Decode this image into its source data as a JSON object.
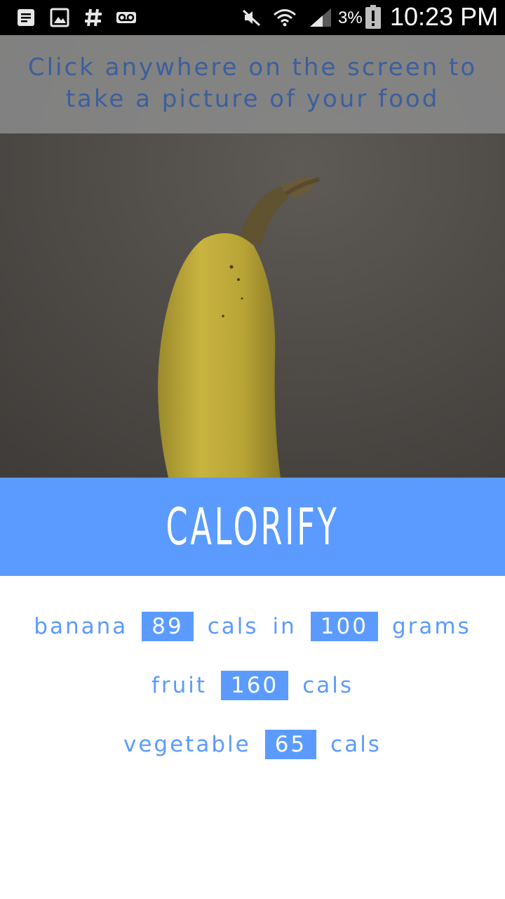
{
  "status_bar": {
    "battery": "3%",
    "time": "10:23 PM",
    "icons": [
      "notes-icon",
      "gallery-icon",
      "hashtag-icon",
      "voicemail-icon",
      "mute-icon",
      "wifi-icon",
      "signal-icon",
      "battery-icon"
    ]
  },
  "camera": {
    "hint": "Click anywhere on the screen to take a picture of your food"
  },
  "banner": {
    "title": "CALORIFY"
  },
  "results": [
    {
      "words": [
        "banana",
        "cals",
        "in",
        "grams"
      ],
      "values": [
        "89",
        "100"
      ]
    },
    {
      "words": [
        "fruit",
        "cals"
      ],
      "values": [
        "160"
      ]
    },
    {
      "words": [
        "vegetable",
        "cals"
      ],
      "values": [
        "65"
      ]
    }
  ],
  "colors": {
    "accent": "#5b9bff",
    "hint_text": "#3c5f9d",
    "hint_bar": "#8c8c8c",
    "status_bar": "#000000"
  }
}
